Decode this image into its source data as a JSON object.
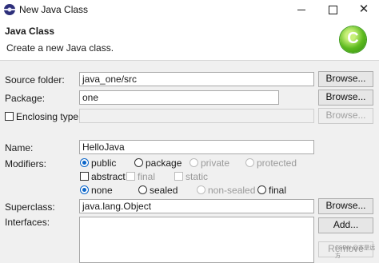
{
  "window": {
    "title": "New Java Class",
    "minimize_icon": "minimize-icon",
    "maximize_icon": "maximize-icon",
    "close_glyph": "✕"
  },
  "banner": {
    "title": "Java Class",
    "description": "Create a new Java class.",
    "icon_letter": "C"
  },
  "source_folder": {
    "label": "Source folder:",
    "value": "java_one/src",
    "button": "Browse..."
  },
  "package": {
    "label": "Package:",
    "value": "one",
    "button": "Browse..."
  },
  "enclosing_type": {
    "label": "Enclosing type:",
    "value": "",
    "checked": false,
    "button": "Browse..."
  },
  "name": {
    "label": "Name:",
    "value": "HelloJava"
  },
  "modifiers": {
    "label": "Modifiers:",
    "access": [
      {
        "label": "public",
        "checked": true,
        "enabled": true
      },
      {
        "label": "package",
        "checked": false,
        "enabled": true
      },
      {
        "label": "private",
        "checked": false,
        "enabled": false
      },
      {
        "label": "protected",
        "checked": false,
        "enabled": false
      }
    ],
    "flags": [
      {
        "label": "abstract",
        "checked": false,
        "enabled": true
      },
      {
        "label": "final",
        "checked": false,
        "enabled": false
      },
      {
        "label": "static",
        "checked": false,
        "enabled": false
      }
    ],
    "sealing": [
      {
        "label": "none",
        "checked": true,
        "enabled": true
      },
      {
        "label": "sealed",
        "checked": false,
        "enabled": true
      },
      {
        "label": "non-sealed",
        "checked": false,
        "enabled": false
      },
      {
        "label": "final",
        "checked": false,
        "enabled": true
      }
    ]
  },
  "superclass": {
    "label": "Superclass:",
    "value": "java.lang.Object",
    "button": "Browse..."
  },
  "interfaces": {
    "label": "Interfaces:",
    "add_button": "Add...",
    "remove_button": "Remove"
  },
  "watermark": "CSDN @亦是远方",
  "colors": {
    "accent": "#0a64c8",
    "banner_bg": "#ffffff",
    "dialog_bg": "#f0f0f0"
  }
}
